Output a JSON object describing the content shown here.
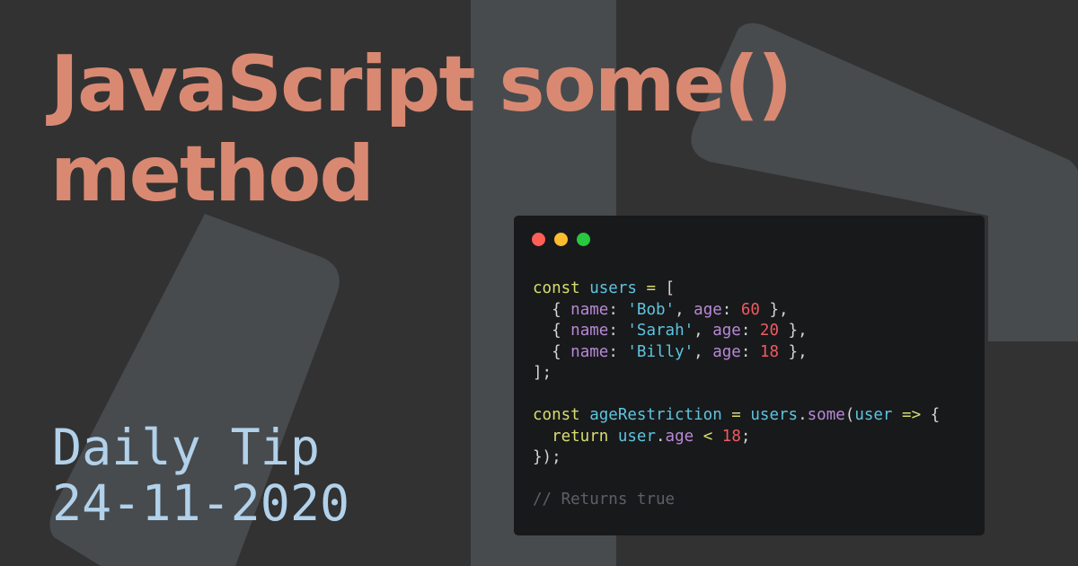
{
  "colors": {
    "background": "#323232",
    "shape": "#474b4e",
    "title": "#d98972",
    "tip": "#b2d1ea",
    "window": "#18191b",
    "dot_red": "#ff5f57",
    "dot_yellow": "#febc2e",
    "dot_green": "#28c840",
    "keyword": "#d8dd6f",
    "variable": "#5ec4df",
    "property": "#b889d6",
    "string": "#5ec4df",
    "number": "#ee5b62",
    "operator": "#d8dd6f",
    "punct": "#d4d4d4",
    "comment": "#5b6067"
  },
  "title": {
    "line1": "JavaScript some()",
    "line2": "method"
  },
  "tip": {
    "line1": "Daily Tip",
    "line2": "24-11-2020"
  },
  "window_controls": [
    "close",
    "minimize",
    "maximize"
  ],
  "code_lines": [
    [
      [
        "kw",
        "const"
      ],
      [
        "p",
        " "
      ],
      [
        "var",
        "users"
      ],
      [
        "p",
        " "
      ],
      [
        "op",
        "="
      ],
      [
        "p",
        " ["
      ]
    ],
    [
      [
        "p",
        "  { "
      ],
      [
        "prop",
        "name"
      ],
      [
        "p",
        ": "
      ],
      [
        "str",
        "'Bob'"
      ],
      [
        "p",
        ", "
      ],
      [
        "prop",
        "age"
      ],
      [
        "p",
        ": "
      ],
      [
        "num",
        "60"
      ],
      [
        "p",
        " },"
      ]
    ],
    [
      [
        "p",
        "  { "
      ],
      [
        "prop",
        "name"
      ],
      [
        "p",
        ": "
      ],
      [
        "str",
        "'Sarah'"
      ],
      [
        "p",
        ", "
      ],
      [
        "prop",
        "age"
      ],
      [
        "p",
        ": "
      ],
      [
        "num",
        "20"
      ],
      [
        "p",
        " },"
      ]
    ],
    [
      [
        "p",
        "  { "
      ],
      [
        "prop",
        "name"
      ],
      [
        "p",
        ": "
      ],
      [
        "str",
        "'Billy'"
      ],
      [
        "p",
        ", "
      ],
      [
        "prop",
        "age"
      ],
      [
        "p",
        ": "
      ],
      [
        "num",
        "18"
      ],
      [
        "p",
        " },"
      ]
    ],
    [
      [
        "p",
        "];"
      ]
    ],
    [],
    [
      [
        "kw",
        "const"
      ],
      [
        "p",
        " "
      ],
      [
        "var",
        "ageRestriction"
      ],
      [
        "p",
        " "
      ],
      [
        "op",
        "="
      ],
      [
        "p",
        " "
      ],
      [
        "var",
        "users"
      ],
      [
        "p",
        "."
      ],
      [
        "prop",
        "some"
      ],
      [
        "p",
        "("
      ],
      [
        "var",
        "user"
      ],
      [
        "p",
        " "
      ],
      [
        "op",
        "=>"
      ],
      [
        "p",
        " {"
      ]
    ],
    [
      [
        "p",
        "  "
      ],
      [
        "kw",
        "return"
      ],
      [
        "p",
        " "
      ],
      [
        "var",
        "user"
      ],
      [
        "p",
        "."
      ],
      [
        "prop",
        "age"
      ],
      [
        "p",
        " "
      ],
      [
        "op",
        "<"
      ],
      [
        "p",
        " "
      ],
      [
        "num",
        "18"
      ],
      [
        "p",
        ";"
      ]
    ],
    [
      [
        "p",
        "});"
      ]
    ],
    [],
    [
      [
        "cm",
        "// Returns true"
      ]
    ]
  ]
}
